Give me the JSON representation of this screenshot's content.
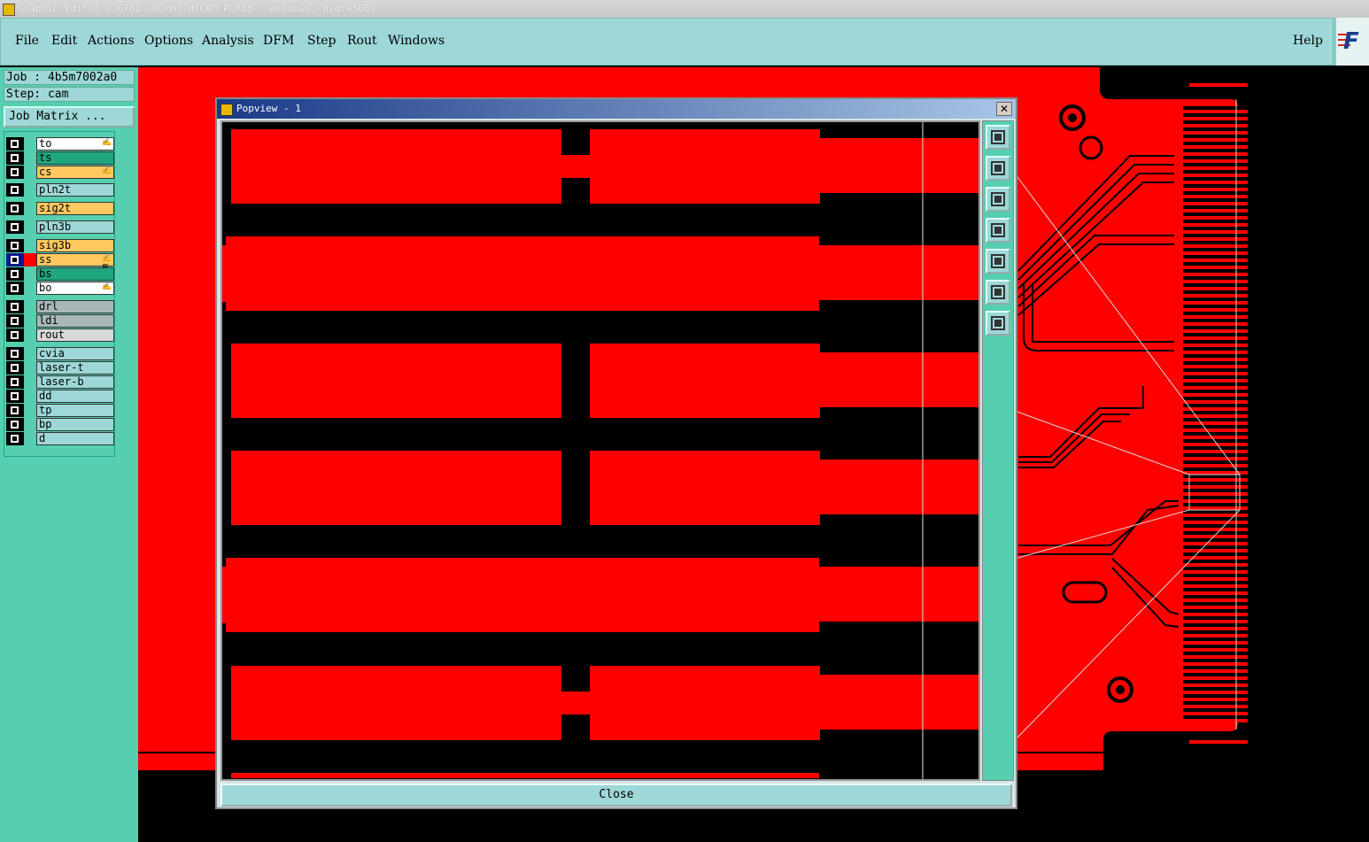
{
  "window": {
    "title": "Graphic Editor 9.07b2 (OO@HY-HYCAM-PC083 - Windows, pid:4508)"
  },
  "menu": {
    "items": [
      "File",
      "Edit",
      "Actions",
      "Options",
      "Analysis",
      "DFM",
      "Step",
      "Rout",
      "Windows"
    ],
    "help": "Help"
  },
  "job": {
    "name": "Job : 4b5m7002a0",
    "step": "Step: cam",
    "matrix_button": "Job Matrix ..."
  },
  "layers": [
    {
      "name": "to",
      "color": "#ffffff",
      "marker": "✍"
    },
    {
      "name": "ts",
      "color": "#1fa67f",
      "marker": ""
    },
    {
      "name": "cs",
      "color": "#ffc860",
      "marker": "✍"
    },
    {
      "name": "pln2t",
      "color": "#9ed7d7",
      "marker": ""
    },
    {
      "name": "sig2t",
      "color": "#ffc860",
      "marker": ""
    },
    {
      "name": "pln3b",
      "color": "#9ed7d7",
      "marker": ""
    },
    {
      "name": "sig3b",
      "color": "#ffc860",
      "marker": ""
    },
    {
      "name": "ss",
      "color": "#ffc860",
      "marker": "✍⊞",
      "active": true
    },
    {
      "name": "bs",
      "color": "#1fa67f",
      "marker": ""
    },
    {
      "name": "bo",
      "color": "#ffffff",
      "marker": "✍"
    },
    {
      "name": "drl",
      "color": "#a8b8b8",
      "marker": ""
    },
    {
      "name": "ldi",
      "color": "#a8b8b8",
      "marker": ""
    },
    {
      "name": "rout",
      "color": "#d8d8d8",
      "marker": ""
    },
    {
      "name": "cvia",
      "color": "#9ed7d7",
      "marker": ""
    },
    {
      "name": "laser-t",
      "color": "#9ed7d7",
      "marker": ""
    },
    {
      "name": "laser-b",
      "color": "#9ed7d7",
      "marker": ""
    },
    {
      "name": "dd",
      "color": "#9ed7d7",
      "marker": ""
    },
    {
      "name": "tp",
      "color": "#9ed7d7",
      "marker": ""
    },
    {
      "name": "bp",
      "color": "#9ed7d7",
      "marker": ""
    },
    {
      "name": "d",
      "color": "#9ed7d7",
      "marker": ""
    }
  ],
  "popview": {
    "title": "Popview - 1",
    "close_label": "Close",
    "close_x": "✕",
    "tools": [
      "zoom-home-icon",
      "pan-up-icon",
      "pan-down-icon",
      "pan-left-icon",
      "pan-right-icon",
      "zoom-in-icon",
      "zoom-out-icon"
    ]
  },
  "colors": {
    "copper": "#ff0000",
    "background": "#000000",
    "panel": "#55cfb0",
    "menu": "#9ed7d7"
  }
}
